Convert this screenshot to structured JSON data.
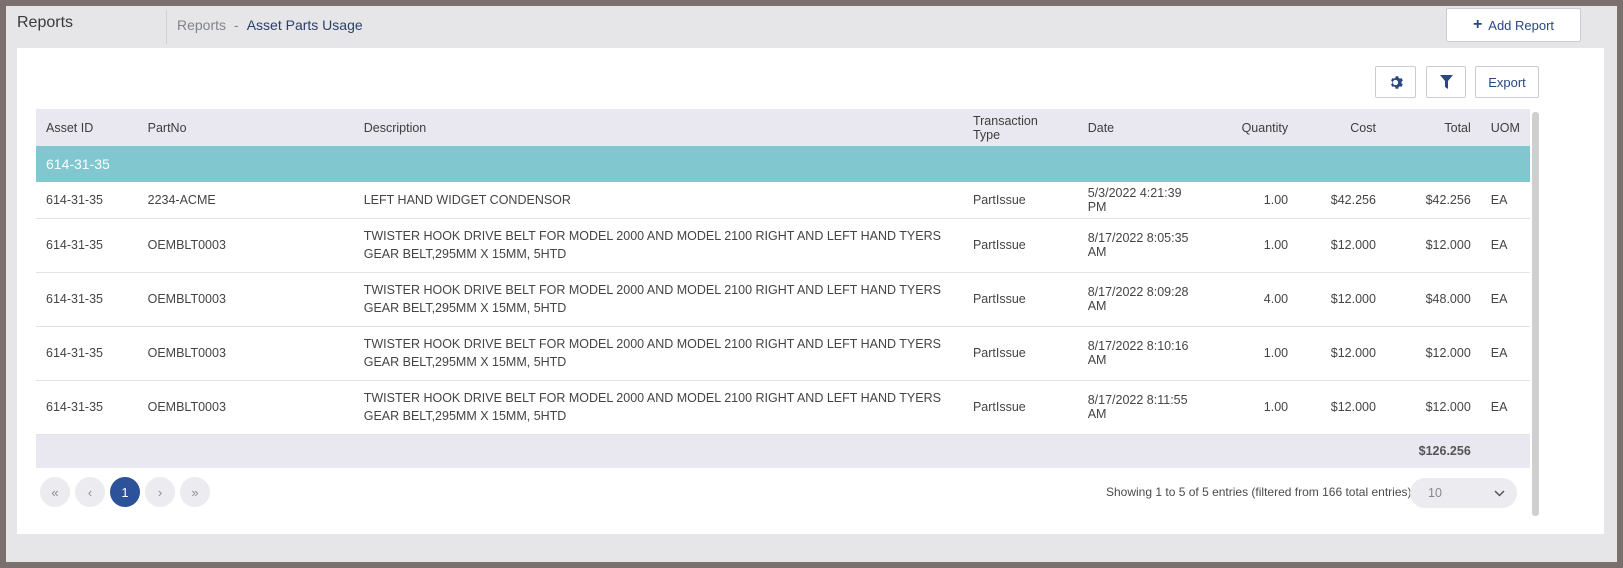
{
  "app": {
    "title": "Reports"
  },
  "breadcrumb": {
    "root": "Reports",
    "separator": "-",
    "current": "Asset Parts Usage"
  },
  "actions": {
    "add_report": "Add Report",
    "export": "Export"
  },
  "icons": {
    "plus": "plus-icon",
    "gear": "gear-icon",
    "filter": "filter-icon"
  },
  "colors": {
    "accent": "#2c5399",
    "group_row": "#80c7d0",
    "header_bg": "#e9e8f0"
  },
  "table": {
    "headers": {
      "asset_id": "Asset ID",
      "part_no": "PartNo",
      "description": "Description",
      "transaction_type": "Transaction Type",
      "date": "Date",
      "quantity": "Quantity",
      "cost": "Cost",
      "total": "Total",
      "uom": "UOM"
    },
    "group_label": "614-31-35",
    "rows": [
      {
        "asset_id": "614-31-35",
        "part_no": "2234-ACME",
        "description": "LEFT HAND WIDGET CONDENSOR",
        "transaction_type": "PartIssue",
        "date": "5/3/2022 4:21:39 PM",
        "quantity": "1.00",
        "cost": "$42.256",
        "total": "$42.256",
        "uom": "EA"
      },
      {
        "asset_id": "614-31-35",
        "part_no": "OEMBLT0003",
        "description": "TWISTER HOOK DRIVE BELT FOR MODEL 2000 AND MODEL 2100 RIGHT AND LEFT HAND TYERS GEAR BELT,295MM X 15MM, 5HTD",
        "transaction_type": "PartIssue",
        "date": "8/17/2022 8:05:35 AM",
        "quantity": "1.00",
        "cost": "$12.000",
        "total": "$12.000",
        "uom": "EA"
      },
      {
        "asset_id": "614-31-35",
        "part_no": "OEMBLT0003",
        "description": "TWISTER HOOK DRIVE BELT FOR MODEL 2000 AND MODEL 2100 RIGHT AND LEFT HAND TYERS GEAR BELT,295MM X 15MM, 5HTD",
        "transaction_type": "PartIssue",
        "date": "8/17/2022 8:09:28 AM",
        "quantity": "4.00",
        "cost": "$12.000",
        "total": "$48.000",
        "uom": "EA"
      },
      {
        "asset_id": "614-31-35",
        "part_no": "OEMBLT0003",
        "description": "TWISTER HOOK DRIVE BELT FOR MODEL 2000 AND MODEL 2100 RIGHT AND LEFT HAND TYERS GEAR BELT,295MM X 15MM, 5HTD",
        "transaction_type": "PartIssue",
        "date": "8/17/2022 8:10:16 AM",
        "quantity": "1.00",
        "cost": "$12.000",
        "total": "$12.000",
        "uom": "EA"
      },
      {
        "asset_id": "614-31-35",
        "part_no": "OEMBLT0003",
        "description": "TWISTER HOOK DRIVE BELT FOR MODEL 2000 AND MODEL 2100 RIGHT AND LEFT HAND TYERS GEAR BELT,295MM X 15MM, 5HTD",
        "transaction_type": "PartIssue",
        "date": "8/17/2022 8:11:55 AM",
        "quantity": "1.00",
        "cost": "$12.000",
        "total": "$12.000",
        "uom": "EA"
      }
    ],
    "grand_total": "$126.256"
  },
  "pagination": {
    "first": "«",
    "prev": "‹",
    "current_page": "1",
    "next": "›",
    "last": "»",
    "info": "Showing 1 to 5 of 5 entries (filtered from 166 total entries)",
    "page_size": "10"
  }
}
